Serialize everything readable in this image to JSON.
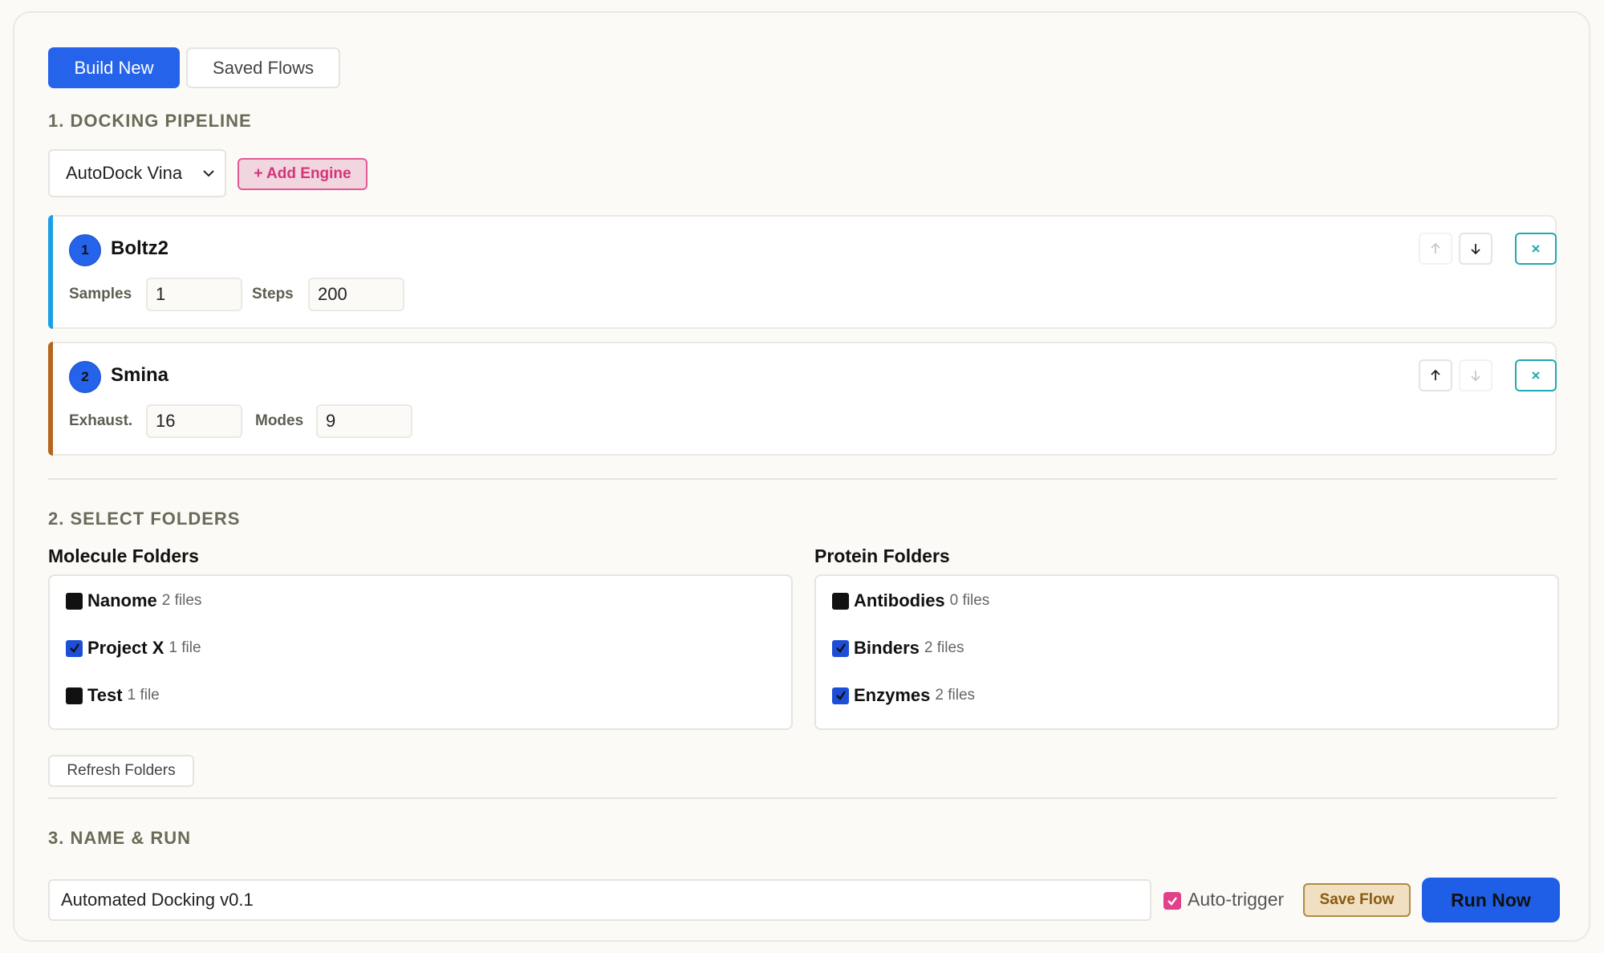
{
  "tabs": [
    {
      "label": "Build New",
      "active": true
    },
    {
      "label": "Saved Flows",
      "active": false
    }
  ],
  "pipeline": {
    "title": "1. DOCKING PIPELINE",
    "engine_select": "AutoDock Vina",
    "add_engine_label": "+ Add Engine",
    "engines": [
      {
        "index": "1",
        "name": "Boltz2",
        "accent": "#1a9ee6",
        "params": [
          {
            "label": "Samples",
            "value": "1"
          },
          {
            "label": "Steps",
            "value": "200"
          }
        ]
      },
      {
        "index": "2",
        "name": "Smina",
        "accent": "#b5651d",
        "params": [
          {
            "label": "Exhaust.",
            "value": "16"
          },
          {
            "label": "Modes",
            "value": "9"
          }
        ]
      }
    ]
  },
  "folders": {
    "title": "2. SELECT FOLDERS",
    "molecule_title": "Molecule Folders",
    "protein_title": "Protein Folders",
    "molecule": [
      {
        "name": "Nanome",
        "count": "2 files",
        "checked": false
      },
      {
        "name": "Project X",
        "count": "1 file",
        "checked": true
      },
      {
        "name": "Test",
        "count": "1 file",
        "checked": false
      }
    ],
    "protein": [
      {
        "name": "Antibodies",
        "count": "0 files",
        "checked": false
      },
      {
        "name": "Binders",
        "count": "2 files",
        "checked": true
      },
      {
        "name": "Enzymes",
        "count": "2 files",
        "checked": true
      }
    ],
    "refresh_label": "Refresh Folders"
  },
  "run": {
    "title": "3. NAME & RUN",
    "flow_name": "Automated Docking v0.1",
    "auto_trigger_label": "Auto-trigger",
    "auto_trigger_checked": true,
    "save_label": "Save Flow",
    "run_label": "Run Now"
  },
  "colors": {
    "primary": "#2563eb",
    "pink": "#e0418a",
    "teal": "#20a9b0",
    "gold": "#b08a45"
  },
  "icons": [
    "chevron-down-icon",
    "arrow-up-icon",
    "arrow-down-icon",
    "close-icon",
    "check-icon"
  ]
}
